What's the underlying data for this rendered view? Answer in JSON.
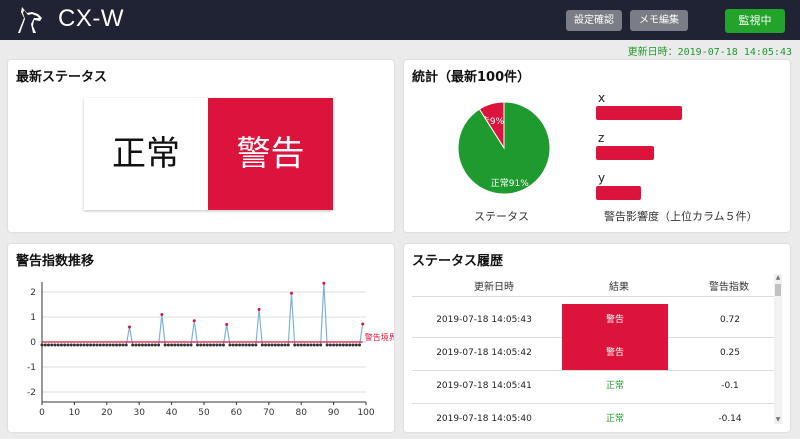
{
  "header": {
    "title": "CX-W",
    "buttons": {
      "settings": "設定確認",
      "memo": "メモ編集",
      "monitor": "監視中"
    },
    "updated": "更新日時：2019-07-18 14:05:43"
  },
  "status_card": {
    "title": "最新ステータス",
    "normal": "正常",
    "warning": "警告"
  },
  "stats_card": {
    "title": "統計（最新100件）",
    "pie_caption": "ステータス",
    "bar_caption": "警告影響度（上位カラム５件）"
  },
  "trend_card": {
    "title": "警告指数推移"
  },
  "history_card": {
    "title": "ステータス履歴",
    "headers": [
      "更新日時",
      "結果",
      "警告指数"
    ],
    "rows": [
      {
        "time": "2019-07-18 14:05:43",
        "result": "警告",
        "index": "0.72",
        "status": "warn"
      },
      {
        "time": "2019-07-18 14:05:42",
        "result": "警告",
        "index": "0.25",
        "status": "warn"
      },
      {
        "time": "2019-07-18 14:05:41",
        "result": "正常",
        "index": "-0.1",
        "status": "ok"
      },
      {
        "time": "2019-07-18 14:05:40",
        "result": "正常",
        "index": "-0.14",
        "status": "ok"
      }
    ]
  },
  "colors": {
    "warn": "#dc143c",
    "ok": "#1f9a2e",
    "header": "#1f2333",
    "line": "#7fb2d6"
  },
  "chart_data": [
    {
      "type": "pie",
      "slices": [
        {
          "label": "警告9%",
          "value": 9,
          "color": "#dc143c"
        },
        {
          "label": "正常91%",
          "value": 91,
          "color": "#1f9a2e"
        }
      ]
    },
    {
      "type": "bar",
      "orientation": "horizontal",
      "categories": [
        "x",
        "z",
        "y"
      ],
      "values": [
        0.86,
        0.58,
        0.45
      ],
      "color": "#dc143c"
    },
    {
      "type": "line",
      "xlim": [
        0,
        100
      ],
      "ylim": [
        -2.4,
        2.4
      ],
      "xticks": [
        0,
        10,
        20,
        30,
        40,
        50,
        60,
        70,
        80,
        90,
        100
      ],
      "yticks": [
        2,
        1,
        0,
        -1,
        -2
      ],
      "baseline": -0.12,
      "spikes": [
        [
          27,
          0.6
        ],
        [
          37,
          1.1
        ],
        [
          47,
          0.85
        ],
        [
          57,
          0.7
        ],
        [
          67,
          1.3
        ],
        [
          77,
          1.95
        ],
        [
          87,
          2.35
        ],
        [
          99,
          0.72
        ]
      ],
      "threshold": {
        "value": 0,
        "label": "警告境界"
      }
    }
  ]
}
